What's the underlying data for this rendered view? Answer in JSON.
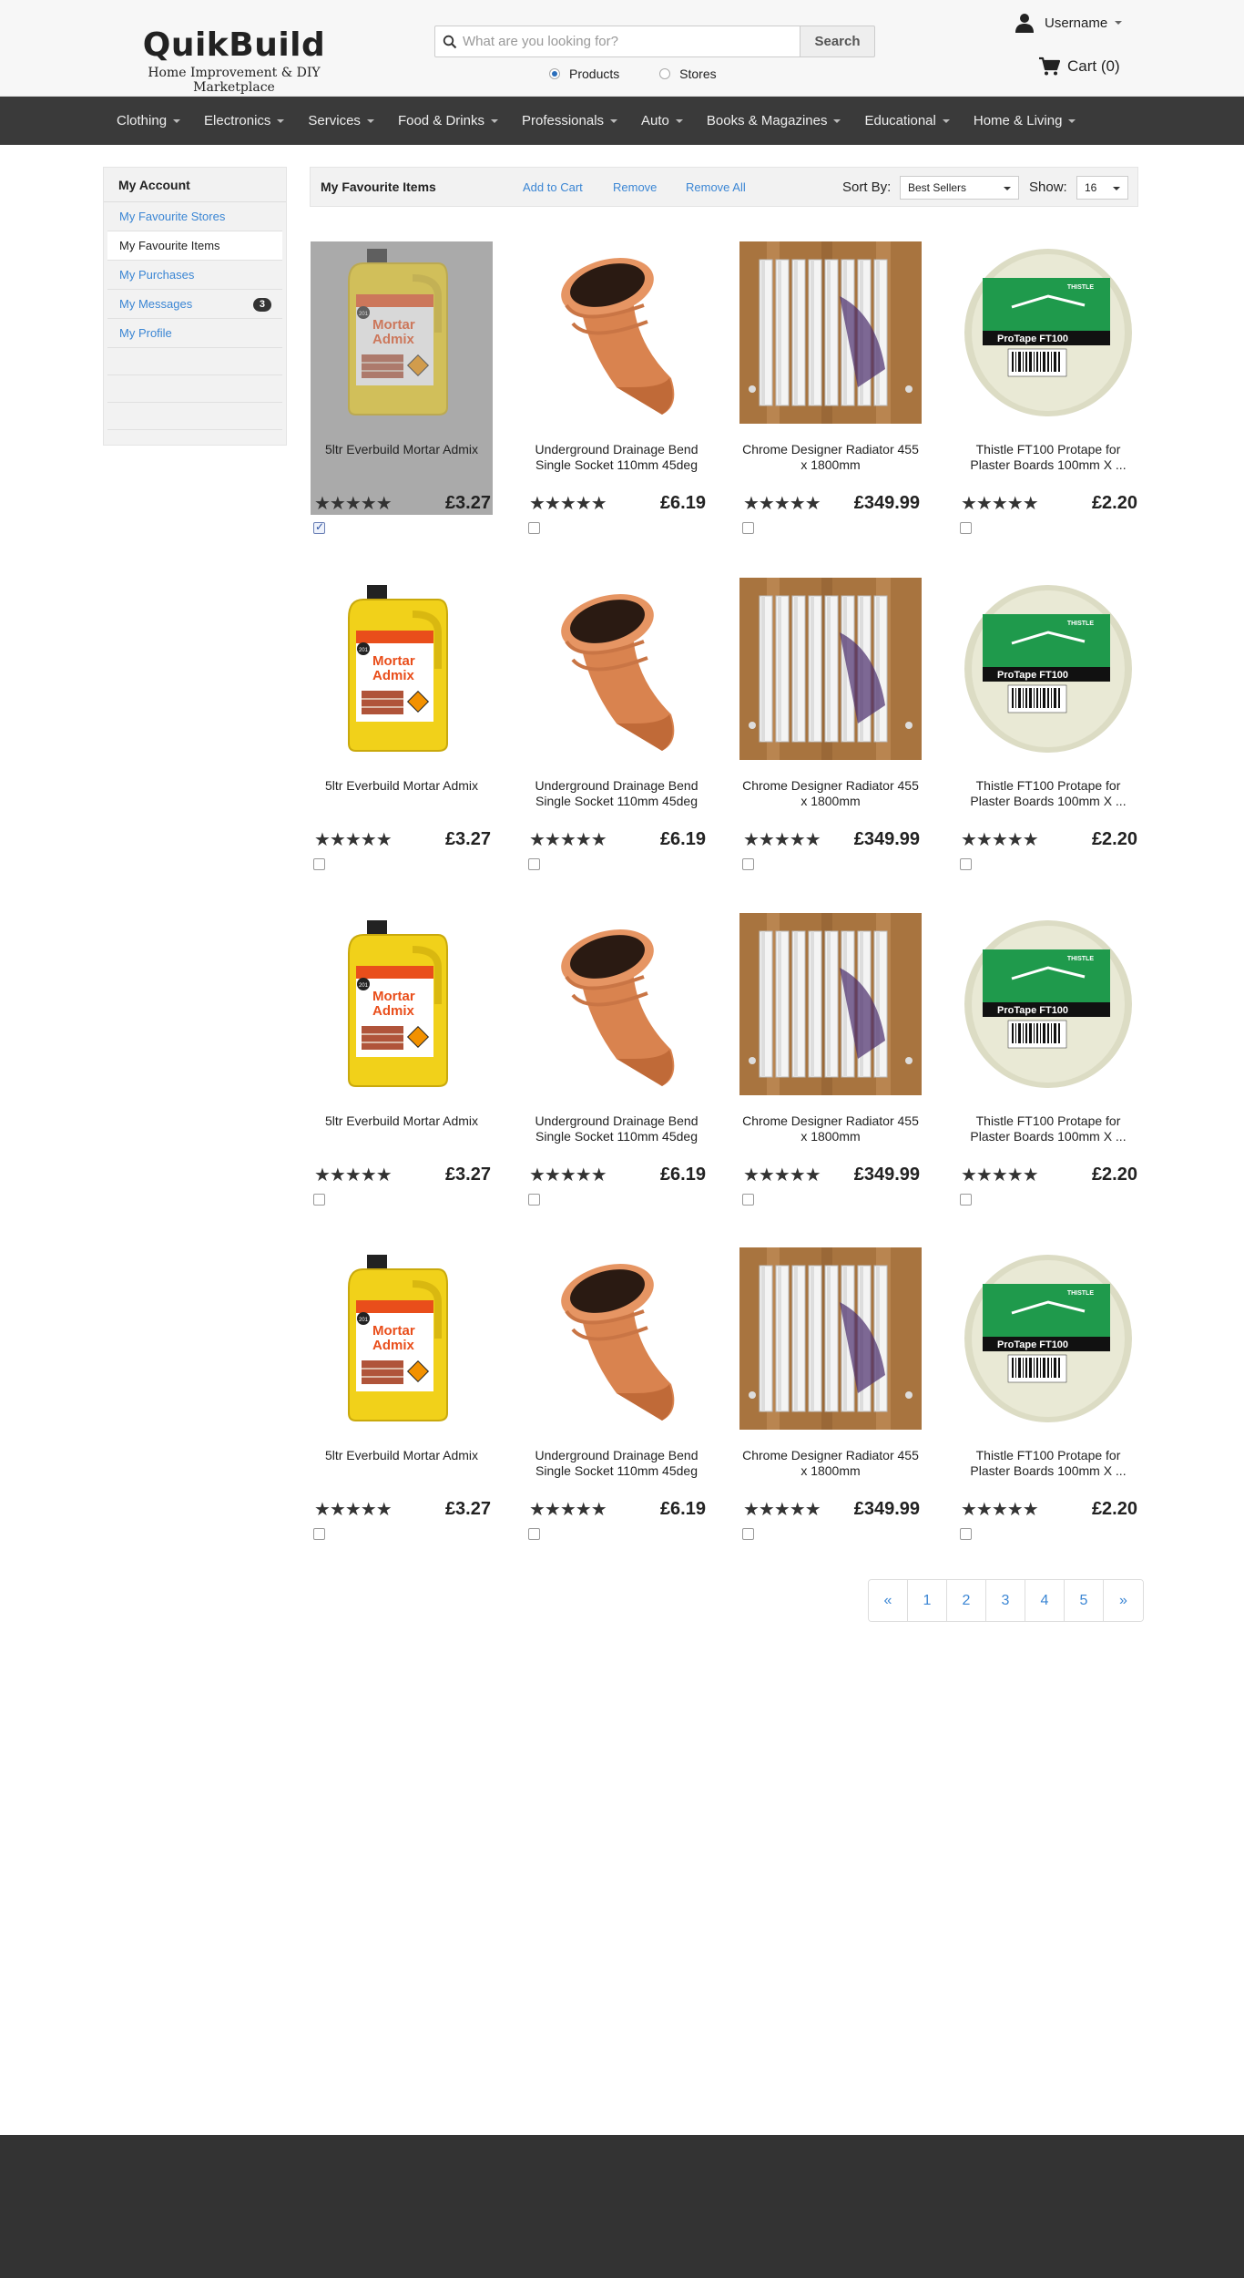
{
  "header": {
    "logo_title": "QuikBuild",
    "logo_tagline": "Home Improvement & DIY Marketplace",
    "search_placeholder": "What are you looking for?",
    "search_button": "Search",
    "scope_products": "Products",
    "scope_stores": "Stores",
    "scope_selected": "Products",
    "username": "Username",
    "cart_label": "Cart (0)"
  },
  "nav": {
    "items": [
      "Clothing",
      "Electronics",
      "Services",
      "Food & Drinks",
      "Professionals",
      "Auto",
      "Books & Magazines",
      "Educational",
      "Home & Living"
    ]
  },
  "sidebar": {
    "title": "My Account",
    "items": [
      {
        "label": "My Favourite Stores",
        "active": false
      },
      {
        "label": "My Favourite Items",
        "active": true
      },
      {
        "label": "My Purchases",
        "active": false
      },
      {
        "label": "My Messages",
        "active": false,
        "badge": "3"
      },
      {
        "label": "My Profile",
        "active": false
      }
    ]
  },
  "toolbar": {
    "title": "My Favourite Items",
    "add_to_cart": "Add to Cart",
    "remove": "Remove",
    "remove_all": "Remove All",
    "sort_label": "Sort By:",
    "sort_value": "Best Sellers",
    "show_label": "Show:",
    "show_value": "16"
  },
  "products": [
    {
      "name": "5ltr Everbuild Mortar Admix",
      "price": "£3.27",
      "rating": 5,
      "image": "mortar-admix",
      "selected": true,
      "checked": true
    },
    {
      "name": "Underground Drainage Bend Single Socket 110mm 45deg",
      "price": "£6.19",
      "rating": 5,
      "image": "drainage-bend",
      "selected": false,
      "checked": false
    },
    {
      "name": "Chrome Designer Radiator 455 x 1800mm",
      "price": "£349.99",
      "rating": 5,
      "image": "radiator",
      "selected": false,
      "checked": false
    },
    {
      "name": "Thistle FT100 Protape for Plaster Boards 100mm X ...",
      "price": "£2.20",
      "rating": 5,
      "image": "protape",
      "selected": false,
      "checked": false
    },
    {
      "name": "5ltr Everbuild Mortar Admix",
      "price": "£3.27",
      "rating": 5,
      "image": "mortar-admix",
      "selected": false,
      "checked": false
    },
    {
      "name": "Underground Drainage Bend Single Socket 110mm 45deg",
      "price": "£6.19",
      "rating": 5,
      "image": "drainage-bend",
      "selected": false,
      "checked": false
    },
    {
      "name": "Chrome Designer Radiator 455 x 1800mm",
      "price": "£349.99",
      "rating": 5,
      "image": "radiator",
      "selected": false,
      "checked": false
    },
    {
      "name": "Thistle FT100 Protape for Plaster Boards 100mm X ...",
      "price": "£2.20",
      "rating": 5,
      "image": "protape",
      "selected": false,
      "checked": false
    },
    {
      "name": "5ltr Everbuild Mortar Admix",
      "price": "£3.27",
      "rating": 5,
      "image": "mortar-admix",
      "selected": false,
      "checked": false
    },
    {
      "name": "Underground Drainage Bend Single Socket 110mm 45deg",
      "price": "£6.19",
      "rating": 5,
      "image": "drainage-bend",
      "selected": false,
      "checked": false
    },
    {
      "name": "Chrome Designer Radiator 455 x 1800mm",
      "price": "£349.99",
      "rating": 5,
      "image": "radiator",
      "selected": false,
      "checked": false
    },
    {
      "name": "Thistle FT100 Protape for Plaster Boards 100mm X ...",
      "price": "£2.20",
      "rating": 5,
      "image": "protape",
      "selected": false,
      "checked": false
    },
    {
      "name": "5ltr Everbuild Mortar Admix",
      "price": "£3.27",
      "rating": 5,
      "image": "mortar-admix",
      "selected": false,
      "checked": false
    },
    {
      "name": "Underground Drainage Bend Single Socket 110mm 45deg",
      "price": "£6.19",
      "rating": 5,
      "image": "drainage-bend",
      "selected": false,
      "checked": false
    },
    {
      "name": "Chrome Designer Radiator 455 x 1800mm",
      "price": "£349.99",
      "rating": 5,
      "image": "radiator",
      "selected": false,
      "checked": false
    },
    {
      "name": "Thistle FT100 Protape for Plaster Boards 100mm X ...",
      "price": "£2.20",
      "rating": 5,
      "image": "protape",
      "selected": false,
      "checked": false
    }
  ],
  "mortar_label": {
    "line1": "Mortar",
    "line2": "Admix",
    "tag": "201"
  },
  "protape_label": {
    "band": "ProTape FT100",
    "top": "THISTLE"
  },
  "pagination": [
    "«",
    "1",
    "2",
    "3",
    "4",
    "5",
    "»"
  ],
  "colors": {
    "link": "#3b86d4",
    "nav_bg": "#3a3a3a",
    "footer_bg": "#333333",
    "selected_bg": "#aaaaaa"
  }
}
